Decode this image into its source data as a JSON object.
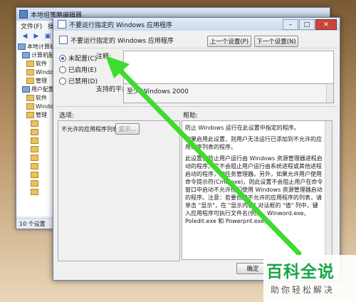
{
  "bg_window": {
    "title": "本地组策略编辑器",
    "menu": [
      "文件(F)",
      "操作(A)"
    ],
    "tree": [
      {
        "label": "本地计算机",
        "kind": "pc",
        "indent": 0
      },
      {
        "label": "计算机配置",
        "kind": "pc",
        "indent": 1
      },
      {
        "label": "软件",
        "kind": "folder",
        "indent": 2
      },
      {
        "label": "Windo",
        "kind": "folder",
        "indent": 2
      },
      {
        "label": "管理",
        "kind": "folder",
        "indent": 2
      },
      {
        "label": "用户配置",
        "kind": "pc",
        "indent": 1
      },
      {
        "label": "软件",
        "kind": "folder",
        "indent": 2
      },
      {
        "label": "Windo",
        "kind": "folder",
        "indent": 2
      },
      {
        "label": "管理",
        "kind": "folder",
        "indent": 2
      },
      {
        "label": "",
        "kind": "folder",
        "indent": 3
      },
      {
        "label": "",
        "kind": "folder",
        "indent": 3
      },
      {
        "label": "",
        "kind": "folder",
        "indent": 3
      },
      {
        "label": "",
        "kind": "folder",
        "indent": 3
      },
      {
        "label": "",
        "kind": "folder",
        "indent": 3
      },
      {
        "label": "",
        "kind": "folder",
        "indent": 3
      },
      {
        "label": "",
        "kind": "folder",
        "indent": 3
      },
      {
        "label": "",
        "kind": "folder",
        "indent": 3
      },
      {
        "label": "",
        "kind": "folder",
        "indent": 3
      }
    ],
    "status": "10 个设置"
  },
  "dialog": {
    "title": "不要运行指定的 Windows 应用程序",
    "header_name": "不要运行指定的 Windows 应用程序",
    "prev_button": "上一个设置(P)",
    "next_button": "下一个设置(N)",
    "radios": [
      {
        "label": "未配置(C)",
        "selected": true
      },
      {
        "label": "已启用(E)",
        "selected": false
      },
      {
        "label": "已禁用(D)",
        "selected": false
      }
    ],
    "comment_label": "注释:",
    "platform_label": "支持的平台:",
    "platform_value": "至少 Windows 2000",
    "options_label": "选项:",
    "help_label": "帮助:",
    "option_item_label": "不允许的应用程序列表",
    "show_button": "显示...",
    "help_paragraphs": [
      "防止 Windows 运行在此设置中指定的程序。",
      "如果启用此设置，则用户无法运行已添加到不允许的应用程序列表的程序。",
      "此设置仅防止用户运行由 Windows 资源管理器进程启动的程序。它不会阻止用户运行由系统进程或其他进程启动的程序，如任务管理器。另外，如果允许用户使用命令提示符(Cmd.exe)，则此设置不会阻止用户在命令窗口中启动不允许他们使用 Windows 资源管理器启动的程序。注意：若要创建不允许的应用程序的列表，请单击 \"显示\"，在 \"显示内容\" 对话框的 \"值\" 列中，键入应用程序可执行文件名(例如，Winword.exe、Poledit.exe 和 Powerpnt.exe)。"
    ],
    "ok_button": "确定"
  },
  "watermark": {
    "big": "百科全说",
    "small": "助你轻松解决"
  },
  "colors": {
    "arrow": "#3ddc2e",
    "watermark_green": "#19a547"
  }
}
